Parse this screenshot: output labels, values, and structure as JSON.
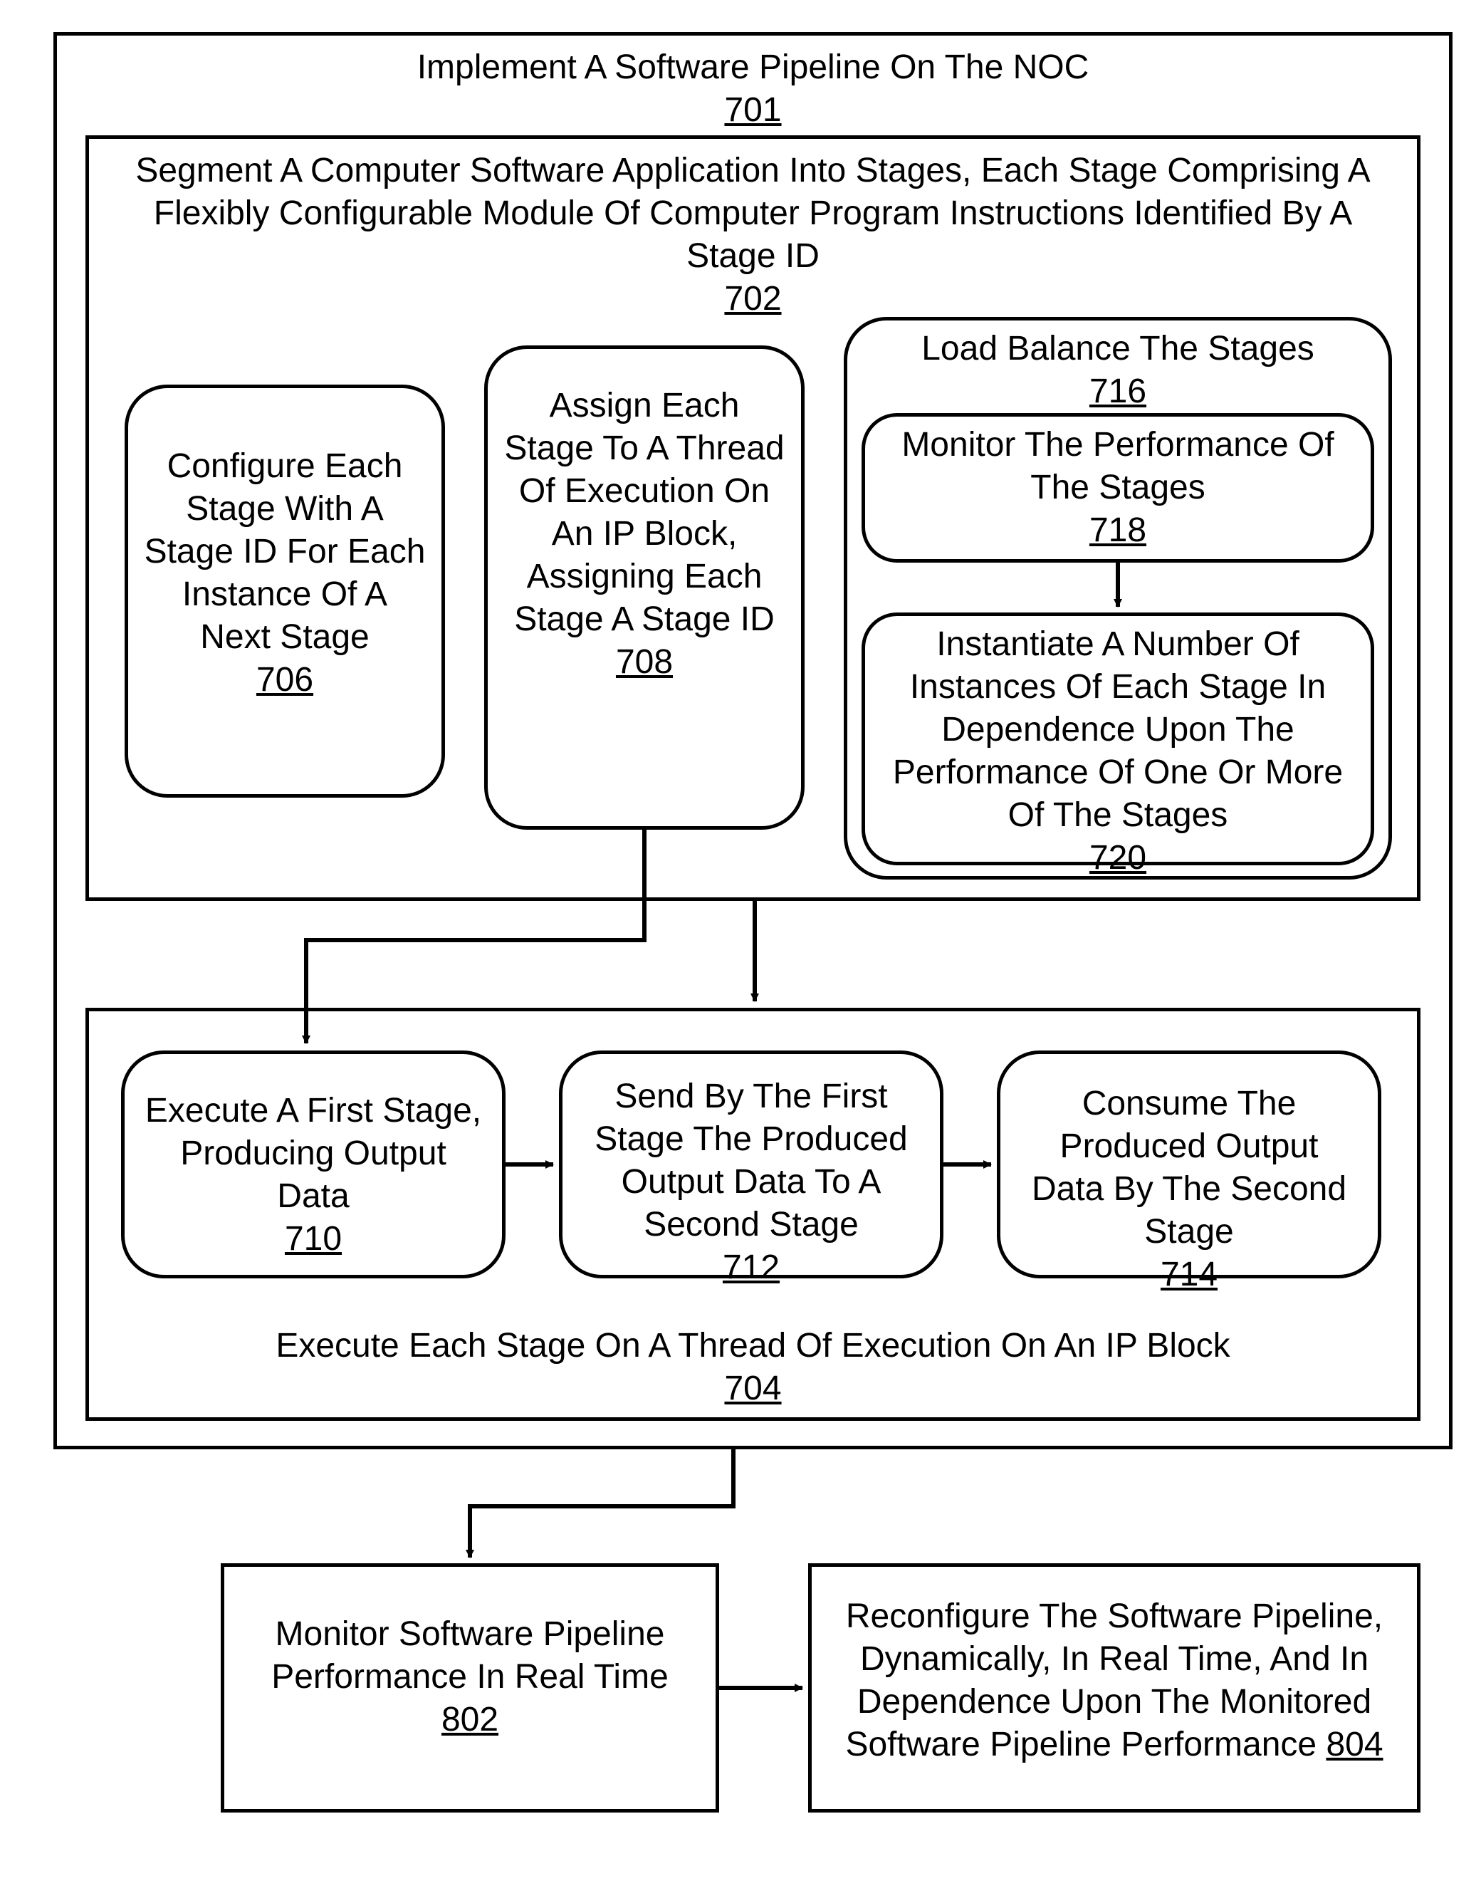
{
  "blocks": {
    "b701": {
      "text": "Implement A Software Pipeline On The NOC",
      "ref": "701"
    },
    "b702": {
      "text": "Segment A Computer Software Application Into Stages, Each Stage Comprising A Flexibly Configurable Module Of Computer Program Instructions Identified By A Stage ID",
      "ref": "702"
    },
    "b706": {
      "text": "Configure Each Stage With A Stage ID For Each Instance Of A Next Stage",
      "ref": "706"
    },
    "b708": {
      "text": "Assign Each Stage To A Thread Of Execution On An IP Block, Assigning Each Stage A Stage ID",
      "ref": "708"
    },
    "b716": {
      "text": "Load Balance The Stages",
      "ref": "716"
    },
    "b718": {
      "text": "Monitor The Performance Of The Stages",
      "ref": "718"
    },
    "b720": {
      "text": "Instantiate A Number Of Instances Of Each Stage In Dependence Upon The Performance Of One Or More Of The Stages",
      "ref": "720"
    },
    "b704": {
      "text": "Execute Each Stage On A Thread Of Execution On An IP Block",
      "ref": "704"
    },
    "b710": {
      "text": "Execute A First Stage, Producing Output Data",
      "ref": "710"
    },
    "b712": {
      "text": "Send By The First Stage The Produced Output Data To A Second Stage",
      "ref": "712"
    },
    "b714": {
      "text": "Consume The Produced Output Data By The Second Stage",
      "ref": "714"
    },
    "b802": {
      "text": "Monitor Software Pipeline Performance In Real Time",
      "ref": "802"
    },
    "b804": {
      "text": "Reconfigure The Software Pipeline, Dynamically, In Real Time, And In Dependence Upon The Monitored Software Pipeline Performance",
      "ref": "804"
    }
  }
}
